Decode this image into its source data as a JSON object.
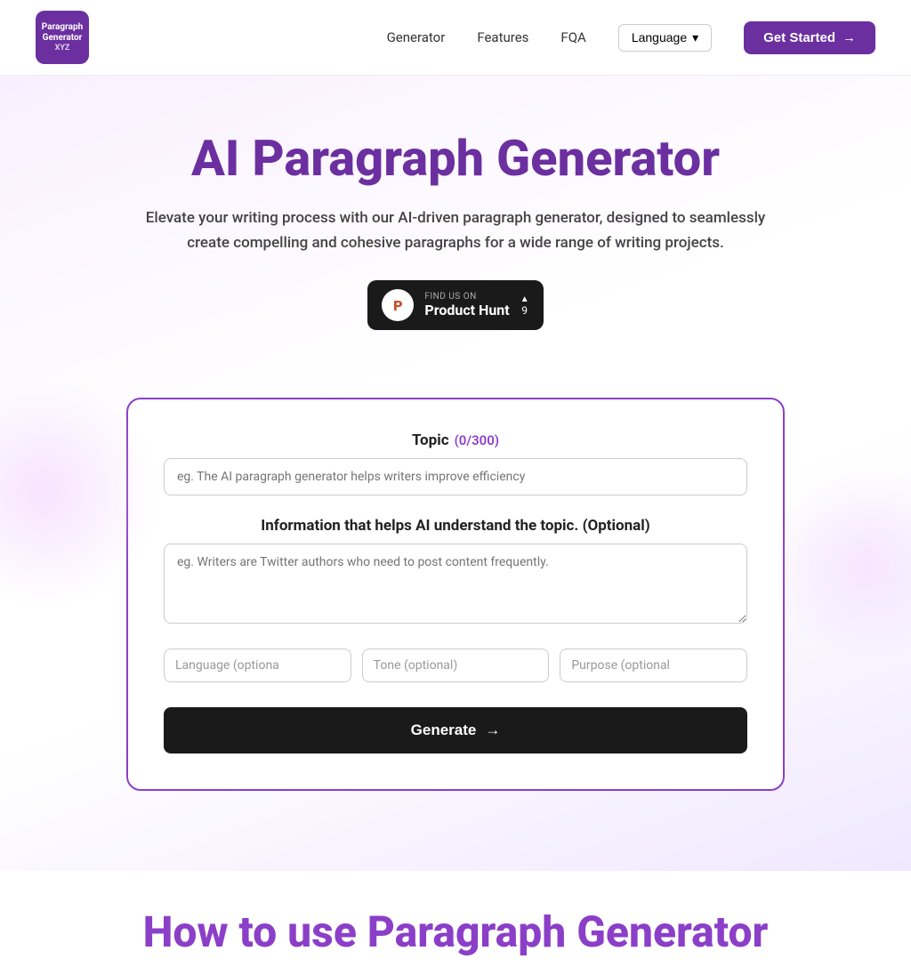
{
  "nav": {
    "logo_line1": "Paragraph",
    "logo_line2": "Generator",
    "logo_line3": "XYZ",
    "links": [
      {
        "label": "Generator",
        "href": "#"
      },
      {
        "label": "Features",
        "href": "#"
      },
      {
        "label": "FQA",
        "href": "#"
      }
    ],
    "language_label": "Language",
    "get_started_label": "Get Started"
  },
  "hero": {
    "title": "AI Paragraph Generator",
    "description": "Elevate your writing process with our AI-driven paragraph generator, designed to seamlessly create compelling and cohesive paragraphs for a wide range of writing projects.",
    "ph_find": "FIND US ON",
    "ph_name": "Product Hunt",
    "ph_votes": "9",
    "ph_letter": "P"
  },
  "form": {
    "topic_label": "Topic",
    "topic_count": "(0/300)",
    "topic_placeholder": "eg. The AI paragraph generator helps writers improve efficiency",
    "info_label": "Information that helps AI understand the topic. (Optional)",
    "info_placeholder": "eg. Writers are Twitter authors who need to post content frequently.",
    "language_placeholder": "Language (optiona",
    "tone_placeholder": "Tone (optional)",
    "purpose_placeholder": "Purpose (optional",
    "generate_label": "Generate",
    "generate_arrow": "→"
  },
  "how": {
    "title": "How to use Paragraph Generator"
  }
}
